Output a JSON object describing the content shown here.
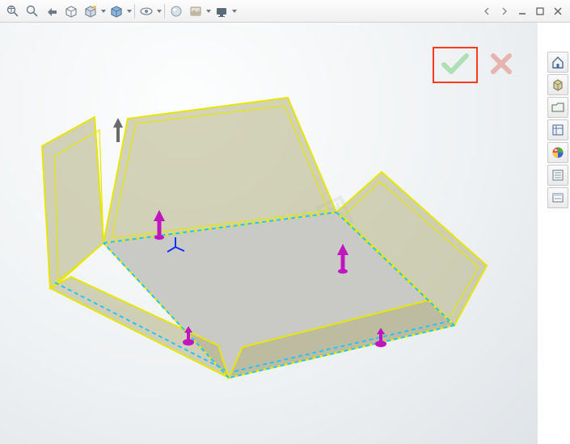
{
  "toolbar": {
    "zoom_fit": "zoom-to-fit",
    "zoom_area": "zoom-to-area",
    "prev_view": "previous-view",
    "section_view": "section-view",
    "dynamic": "view-orientation",
    "display_style": "display-style",
    "hide_show": "hide-show-items",
    "edit_appearance": "edit-appearance",
    "apply_scene": "apply-scene",
    "view_settings": "view-settings",
    "render": "render-tools"
  },
  "window_controls": {
    "prev": "◀",
    "next": "▶",
    "minimize": "─",
    "maximize": "❐",
    "close": "✕"
  },
  "confirm": {
    "ok": "✓",
    "cancel": "✕"
  },
  "right_panel": {
    "home": "home",
    "part": "new-part",
    "open": "open",
    "properties": "properties",
    "appearances": "appearances",
    "decals": "custom-properties",
    "notes": "design-library"
  },
  "watermark": "软件自学网"
}
